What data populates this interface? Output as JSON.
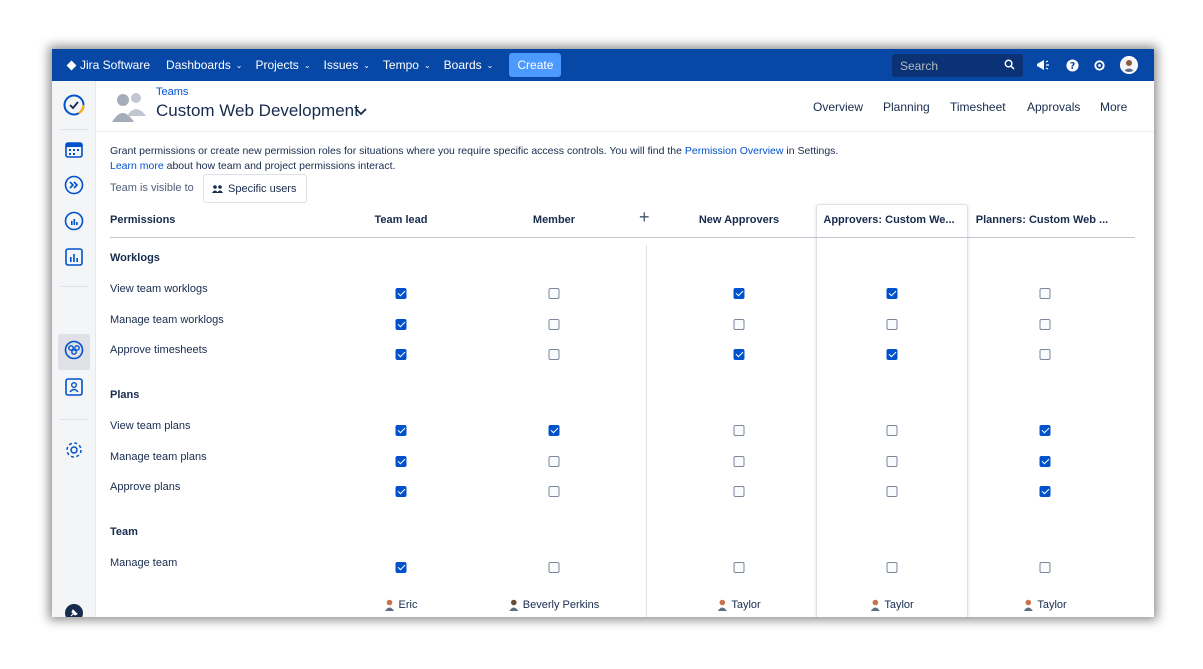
{
  "topnav": {
    "brand": "Jira Software",
    "items": [
      {
        "label": "Dashboards"
      },
      {
        "label": "Projects"
      },
      {
        "label": "Issues"
      },
      {
        "label": "Tempo"
      },
      {
        "label": "Boards"
      }
    ],
    "create_label": "Create",
    "search_placeholder": "Search",
    "icons": [
      "notifications-icon",
      "help-icon",
      "settings-icon",
      "profile-avatar"
    ]
  },
  "sidebar": {
    "icons": [
      "tempo-logo-icon",
      "calendar-icon",
      "forward-icon",
      "reports-gauge-icon",
      "chart-icon",
      "teams-icon",
      "account-icon",
      "settings-gear-icon",
      "pin-icon"
    ],
    "active": "teams-icon"
  },
  "header": {
    "breadcrumb": "Teams",
    "title": "Custom Web Development",
    "tabs": [
      {
        "label": "Overview"
      },
      {
        "label": "Planning"
      },
      {
        "label": "Timesheet"
      },
      {
        "label": "Approvals"
      },
      {
        "label": "More"
      }
    ]
  },
  "intro": {
    "text_before": "Grant permissions or create new permission roles for situations where you require specific access controls. You will find the ",
    "link_overview": "Permission Overview",
    "text_after": " in Settings.",
    "link_learn": "Learn more",
    "text_learn_after": " about how team and project permissions interact."
  },
  "visibility": {
    "label": "Team is visible to",
    "button": "Specific users"
  },
  "table": {
    "permissions_header": "Permissions",
    "columns": [
      {
        "label": "Team lead"
      },
      {
        "label": "Member"
      },
      {
        "label": "New Approvers"
      },
      {
        "label": "Approvers: Custom We..."
      },
      {
        "label": "Planners: Custom Web ..."
      }
    ],
    "sections": [
      {
        "title": "Worklogs",
        "rows": [
          {
            "label": "View team worklogs",
            "checks": [
              true,
              false,
              true,
              true,
              false
            ]
          },
          {
            "label": "Manage team worklogs",
            "checks": [
              true,
              false,
              false,
              false,
              false
            ]
          },
          {
            "label": "Approve timesheets",
            "checks": [
              true,
              false,
              true,
              true,
              false
            ]
          }
        ]
      },
      {
        "title": "Plans",
        "rows": [
          {
            "label": "View team plans",
            "checks": [
              true,
              true,
              false,
              false,
              true
            ]
          },
          {
            "label": "Manage team plans",
            "checks": [
              true,
              false,
              false,
              false,
              true
            ]
          },
          {
            "label": "Approve plans",
            "checks": [
              true,
              false,
              false,
              false,
              true
            ]
          }
        ]
      },
      {
        "title": "Team",
        "rows": [
          {
            "label": "Manage team",
            "checks": [
              true,
              false,
              false,
              false,
              false
            ]
          }
        ]
      }
    ],
    "assignees": [
      "Eric",
      "Beverly Perkins",
      "Taylor",
      "Taylor",
      "Taylor"
    ]
  },
  "colors": {
    "nav_bg": "#0747a6",
    "accent": "#0052cc",
    "create_btn": "#4c9aff",
    "sidebar_bg": "#f4f5f7"
  }
}
